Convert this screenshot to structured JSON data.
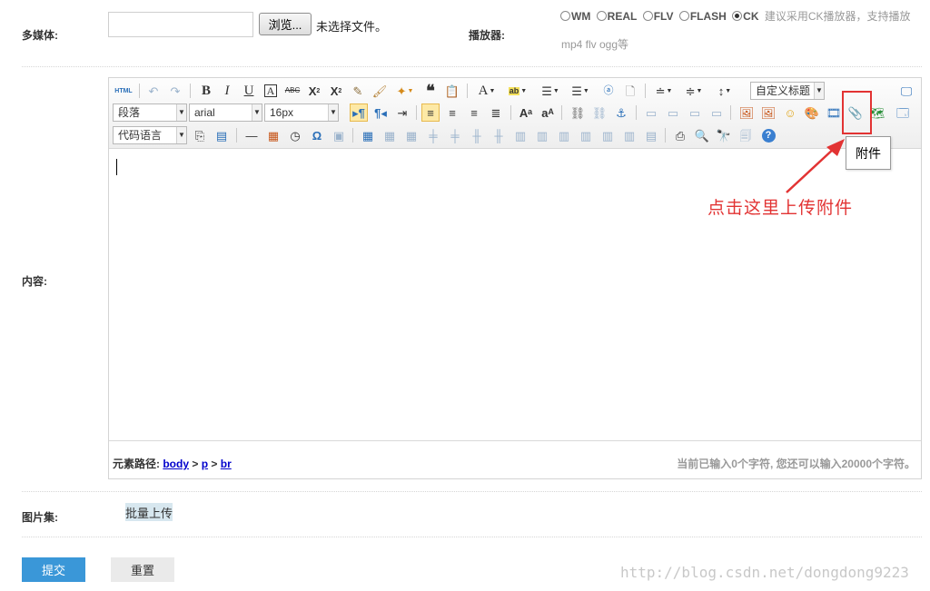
{
  "media": {
    "label": "多媒体:",
    "browse_label": "浏览...",
    "no_file_text": "未选择文件。",
    "player_label": "播放器:",
    "player_options": [
      "WM",
      "REAL",
      "FLV",
      "FLASH",
      "CK"
    ],
    "selected_player": "CK",
    "player_hint_line1": "建议采用CK播放器，支持播放",
    "player_hint_line2": "mp4 flv ogg等"
  },
  "content": {
    "label": "内容:",
    "toolbar": {
      "html_label": "HTML",
      "custom_title": "自定义标题",
      "paragraph": "段落",
      "font_family": "arial",
      "font_size": "16px",
      "code_language": "代码语言"
    },
    "status": {
      "path_label": "元素路径:",
      "path_items": [
        "body",
        "p",
        "br"
      ],
      "path_separator": ">",
      "char_count": "当前已输入0个字符, 您还可以输入20000个字符。"
    },
    "tooltip": "附件",
    "annotation": "点击这里上传附件"
  },
  "gallery": {
    "label": "图片集:",
    "batch_upload": "批量上传"
  },
  "actions": {
    "submit": "提交",
    "reset": "重置"
  },
  "watermark": "http://blog.csdn.net/dongdong9223",
  "colors": {
    "accent": "#3a97d8",
    "annotation": "#e23333",
    "link": "#0000cc"
  }
}
